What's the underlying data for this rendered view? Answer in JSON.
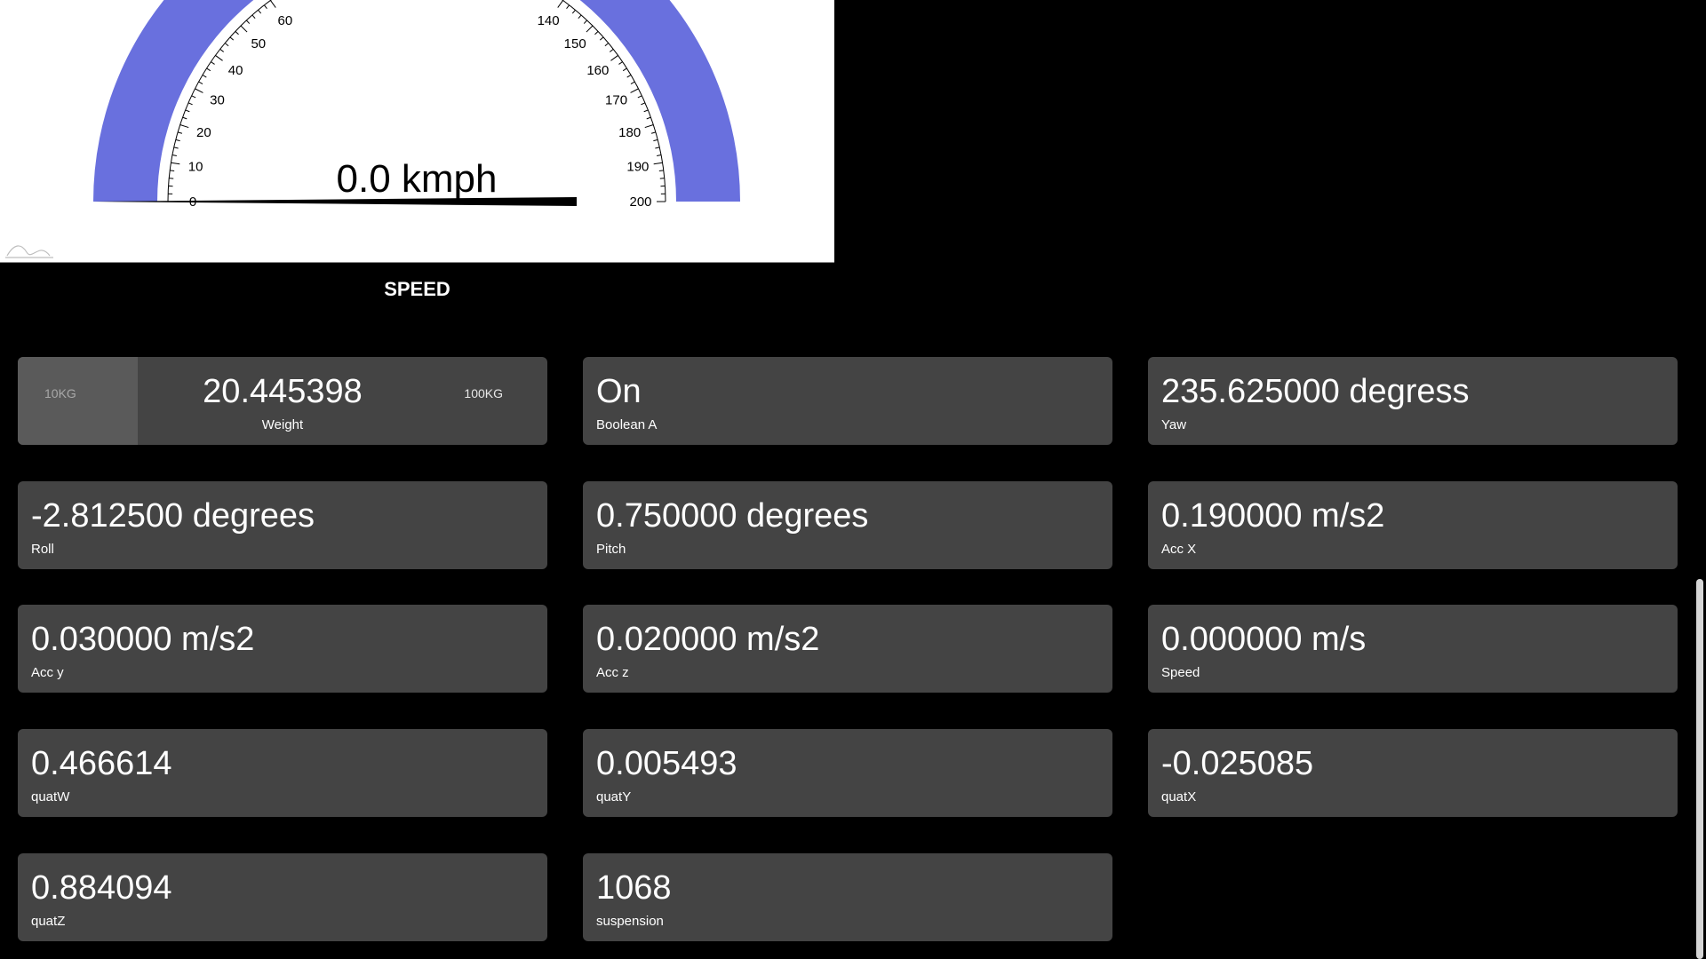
{
  "gauge": {
    "title": "SPEED",
    "value": 0.0,
    "unit": "kmph",
    "value_text": "0.0 kmph",
    "min": 0,
    "max": 200,
    "visible_ticks": [
      0,
      10,
      20,
      30,
      40,
      50,
      60,
      140,
      150,
      160,
      170,
      180,
      190,
      200
    ],
    "arc_color": "#6970de",
    "needle_color": "#000000"
  },
  "cards": [
    {
      "label": "Weight",
      "value": "20.445398",
      "min_label": "10KG",
      "max_label": "100KG",
      "level_fraction": 0.227
    },
    {
      "label": "Boolean A",
      "value": "On"
    },
    {
      "label": "Yaw",
      "value": "235.625000 degress"
    },
    {
      "label": "Roll",
      "value": "-2.812500 degrees"
    },
    {
      "label": "Pitch",
      "value": "0.750000 degrees"
    },
    {
      "label": "Acc X",
      "value": "0.190000 m/s2"
    },
    {
      "label": "Acc y",
      "value": "0.030000 m/s2"
    },
    {
      "label": "Acc z",
      "value": "0.020000 m/s2"
    },
    {
      "label": "Speed",
      "value": "0.000000 m/s"
    },
    {
      "label": "quatW",
      "value": "0.466614"
    },
    {
      "label": "quatY",
      "value": "0.005493"
    },
    {
      "label": "quatX",
      "value": "-0.025085"
    },
    {
      "label": "quatZ",
      "value": "0.884094"
    },
    {
      "label": "suspension",
      "value": "1068"
    }
  ],
  "colors": {
    "page_background": "#000000",
    "card_background": "#444444",
    "weight_fill": "#5a5a5a",
    "gauge_panel": "#ffffff"
  }
}
